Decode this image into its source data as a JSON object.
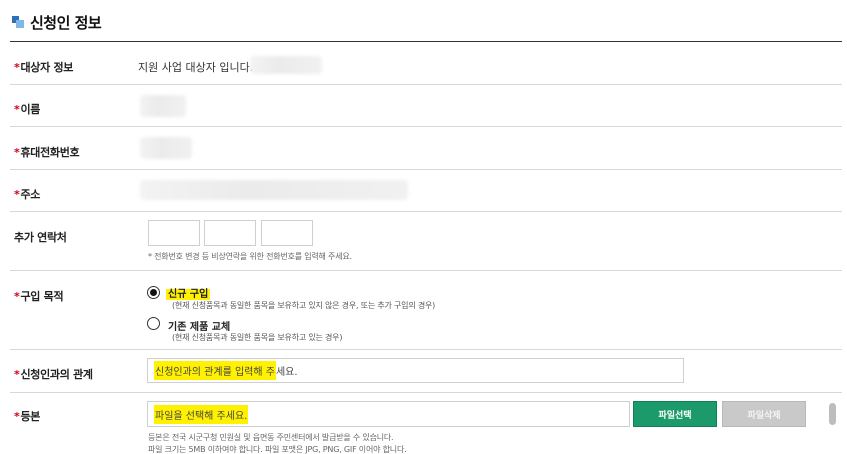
{
  "section": {
    "title": "신청인 정보"
  },
  "rows": {
    "target": {
      "label": "대상자 정보",
      "value": "지원 사업 대상자 입니다."
    },
    "name": {
      "label": "이름"
    },
    "mobile": {
      "label": "휴대전화번호"
    },
    "address": {
      "label": "주소"
    },
    "extra_contact": {
      "label": "추가 연락처",
      "note": "* 전화번호 변경 등 비상연락을 위한 전화번호를 입력해 주세요.",
      "part1": "",
      "part2": "",
      "part3": ""
    },
    "purpose": {
      "label": "구입 목적",
      "options": [
        {
          "label": "신규 구입",
          "desc": "(현재 신청품목과 동일한 품목을 보유하고 있지 않은 경우, 또는 추가 구입의 경우)",
          "selected": true
        },
        {
          "label": "기존 제품 교체",
          "desc": "(현재 신청품목과 동일한 품목을 보유하고 있는 경우)",
          "selected": false
        }
      ]
    },
    "relation": {
      "label": "신청인과의 관계",
      "placeholder_hl": "신청인과의 관계를 입력해 주",
      "placeholder_rest": "세요."
    },
    "document": {
      "label": "등본",
      "placeholder_hl": "파일을 선택해 주세요.",
      "select_button": "파일선택",
      "delete_button": "파일삭제",
      "note1": "등본은 전국 시군구청 민원실 및 읍면동 주민센터에서 발급받을 수 있습니다.",
      "note2": "파일 크기는 5MB 이하여야 합니다. 파일 포맷은 JPG, PNG, GIF 이어야 합니다."
    }
  },
  "colors": {
    "accent_green": "#1d9a6c",
    "highlight": "#fff100",
    "required": "#d0021b"
  }
}
